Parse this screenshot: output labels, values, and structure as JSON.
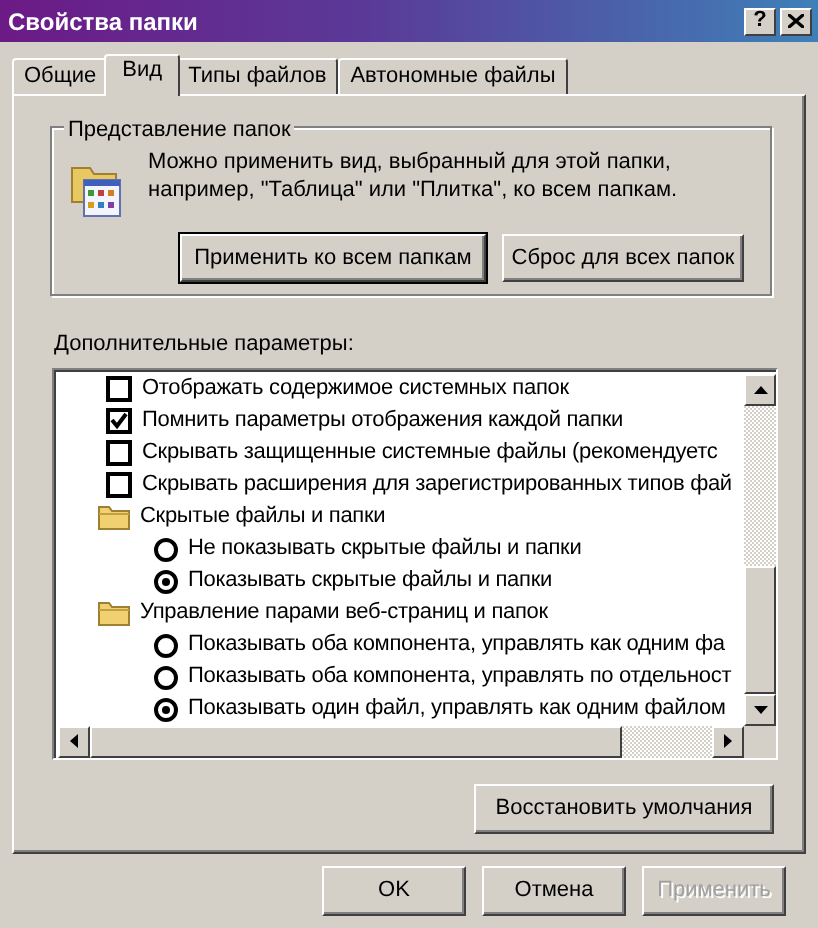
{
  "window": {
    "title": "Свойства папки",
    "help": "?"
  },
  "tabs": [
    {
      "label": "Общие",
      "selected": false
    },
    {
      "label": "Вид",
      "selected": true
    },
    {
      "label": "Типы файлов",
      "selected": false
    },
    {
      "label": "Автономные файлы",
      "selected": false
    }
  ],
  "folder_views": {
    "title": "Представление папок",
    "description": "Можно применить вид, выбранный для этой папки, например, \"Таблица\" или \"Плитка\", ко всем папкам.",
    "buttons": [
      {
        "label": "Применить ко всем папкам",
        "default": true
      },
      {
        "label": "Сброс для всех папок",
        "default": false
      }
    ]
  },
  "advanced": {
    "label": "Дополнительные параметры:",
    "items": [
      {
        "kind": "checkbox",
        "label": "Отображать содержимое системных папок",
        "checked": false
      },
      {
        "kind": "checkbox",
        "label": "Помнить параметры отображения каждой папки",
        "checked": true
      },
      {
        "kind": "checkbox",
        "label": "Скрывать защищенные системные файлы (рекомендуетс",
        "checked": false
      },
      {
        "kind": "checkbox",
        "label": "Скрывать расширения для зарегистрированных типов фай",
        "checked": false
      },
      {
        "kind": "folder",
        "label": "Скрытые файлы и папки",
        "children": [
          {
            "kind": "radio",
            "label": "Не показывать скрытые файлы и папки",
            "selected": false
          },
          {
            "kind": "radio",
            "label": "Показывать скрытые файлы и папки",
            "selected": true
          }
        ]
      },
      {
        "kind": "folder",
        "label": "Управление парами веб-страниц и папок",
        "children": [
          {
            "kind": "radio",
            "label": "Показывать оба компонента, управлять как одним фа",
            "selected": false
          },
          {
            "kind": "radio",
            "label": "Показывать оба компонента, управлять по отдельност",
            "selected": false
          },
          {
            "kind": "radio",
            "label": "Показывать один файл, управлять как одним файлом",
            "selected": true
          }
        ]
      }
    ],
    "restore_button": "Восстановить умолчания"
  },
  "dialog_buttons": [
    {
      "label": "OK",
      "disabled": false
    },
    {
      "label": "Отмена",
      "disabled": false
    },
    {
      "label": "Применить",
      "disabled": true
    }
  ]
}
